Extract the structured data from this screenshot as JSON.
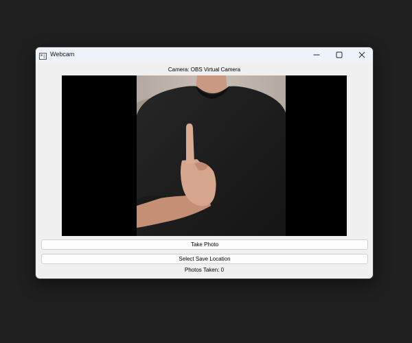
{
  "window": {
    "title": "Webcam",
    "icon": "window-app-icon",
    "controls": {
      "minimize_icon": "minimize-icon",
      "maximize_icon": "maximize-icon",
      "close_icon": "close-icon"
    }
  },
  "camera": {
    "label": "Camera: OBS Virtual Camera"
  },
  "video": {
    "content": "live-camera-feed",
    "background_color": "#000000"
  },
  "buttons": {
    "take_photo": "Take Photo",
    "select_save_location": "Select Save Location"
  },
  "status": {
    "photos_taken": "Photos Taken: 0"
  },
  "colors": {
    "desktop_background": "#1f1f1f",
    "window_background": "#f0f0f0",
    "titlebar_background": "#eef3f9"
  }
}
